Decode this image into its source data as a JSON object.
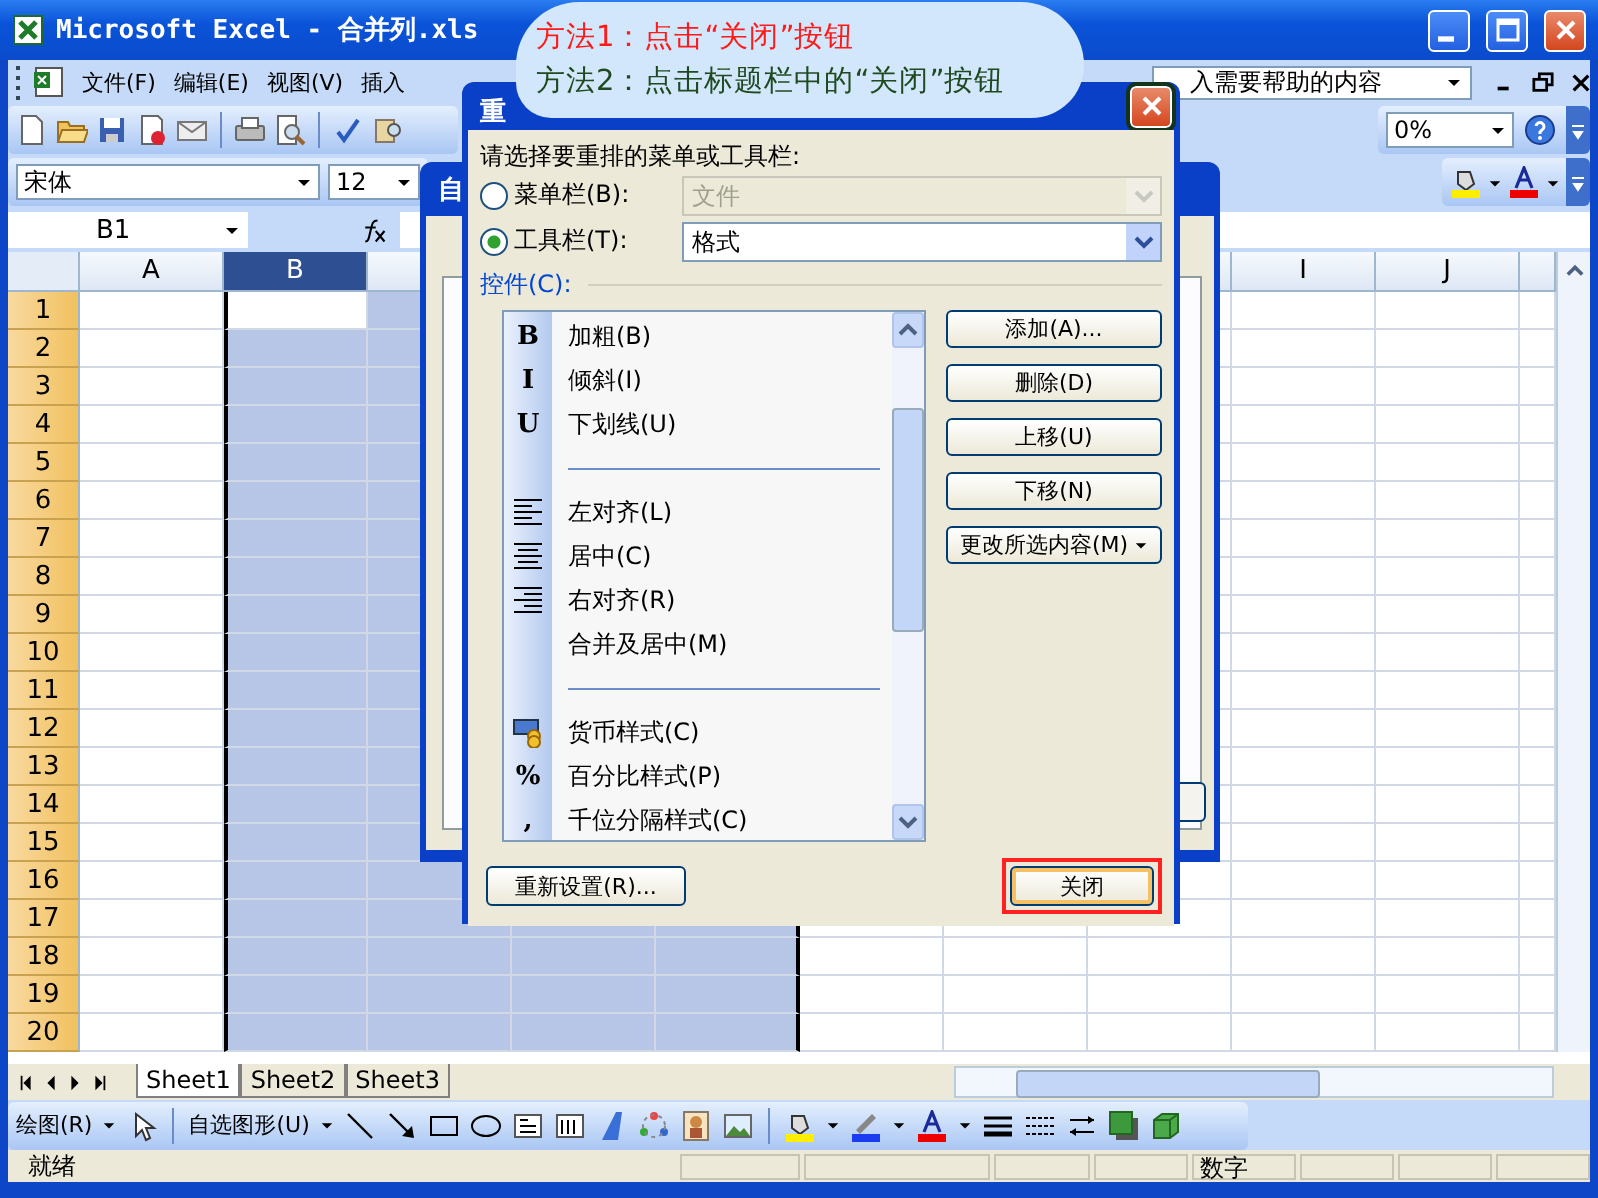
{
  "window": {
    "title": "Microsoft Excel - 合并列.xls"
  },
  "menu": {
    "items": [
      "文件(F)",
      "编辑(E)",
      "视图(V)",
      "插入"
    ],
    "help_placeholder": "入需要帮助的内容"
  },
  "standard_toolbar": {
    "zoom": "0%"
  },
  "formatting_toolbar": {
    "font": "宋体",
    "size": "12"
  },
  "formula_bar": {
    "name_box": "B1"
  },
  "grid": {
    "columns": [
      {
        "label": "A",
        "selected": false,
        "active": false
      },
      {
        "label": "B",
        "selected": true,
        "active": true
      },
      {
        "selected": true
      },
      {
        "selected": true
      },
      {
        "selected": true
      },
      {
        "selected": false
      },
      {
        "selected": false
      },
      {
        "selected": false
      },
      {
        "label": "I",
        "selected": false,
        "active": false
      },
      {
        "label": "J",
        "selected": false,
        "active": false
      }
    ],
    "rows": [
      {
        "label": "1",
        "active": true
      },
      {
        "label": "2",
        "active": false
      },
      {
        "label": "3",
        "active": false
      },
      {
        "label": "4",
        "active": false
      },
      {
        "label": "5",
        "active": false
      },
      {
        "label": "6",
        "active": false
      },
      {
        "label": "7",
        "active": false
      },
      {
        "label": "8",
        "active": false
      },
      {
        "label": "9",
        "active": false
      },
      {
        "label": "10",
        "active": false
      },
      {
        "label": "11",
        "active": false
      },
      {
        "label": "12",
        "active": false
      },
      {
        "label": "13",
        "active": false
      },
      {
        "label": "14",
        "active": false
      },
      {
        "label": "15",
        "active": false
      },
      {
        "label": "16",
        "active": false
      },
      {
        "label": "17",
        "active": false
      },
      {
        "label": "18",
        "active": false
      },
      {
        "label": "19",
        "active": false
      },
      {
        "label": "20",
        "active": false
      }
    ]
  },
  "sheets": [
    {
      "label": "Sheet1",
      "selected": true
    },
    {
      "label": "Sheet2",
      "selected": false
    },
    {
      "label": "Sheet3",
      "selected": false
    }
  ],
  "drawing_toolbar": {
    "draw_menu": "绘图(R)",
    "autoshapes_menu": "自选图形(U)"
  },
  "status_bar": {
    "state": "就绪",
    "mode": "数字"
  },
  "back_dialog": {
    "title": "自"
  },
  "dialog": {
    "title": "重",
    "prompt": "请选择要重排的菜单或工具栏:",
    "options": [
      {
        "label": "菜单栏(B):",
        "selected": false,
        "value": "文件",
        "disabled": true
      },
      {
        "label": "工具栏(T):",
        "selected": true,
        "value": "格式",
        "disabled": false
      }
    ],
    "controls_label": "控件(C):",
    "controls": [
      {
        "kind": "glyph",
        "glyph": "B",
        "label": "加粗(B)"
      },
      {
        "kind": "glyph",
        "glyph": "I",
        "label": "倾斜(I)"
      },
      {
        "kind": "glyph",
        "glyph": "U",
        "label": "下划线(U)"
      },
      {
        "kind": "separator"
      },
      {
        "kind": "left",
        "label": "左对齐(L)"
      },
      {
        "kind": "center",
        "label": "居中(C)"
      },
      {
        "kind": "right",
        "label": "右对齐(R)"
      },
      {
        "kind": "plain",
        "label": "合并及居中(M)"
      },
      {
        "kind": "separator"
      },
      {
        "kind": "currency",
        "label": "货币样式(C)"
      },
      {
        "kind": "glyph",
        "glyph": "%",
        "label": "百分比样式(P)"
      },
      {
        "kind": "glyph",
        "glyph": ",",
        "label": "千位分隔样式(C)"
      }
    ],
    "buttons": [
      {
        "label": "添加(A)...",
        "dropdown": false
      },
      {
        "label": "删除(D)",
        "dropdown": false
      },
      {
        "label": "上移(U)",
        "dropdown": false
      },
      {
        "label": "下移(N)",
        "dropdown": false
      },
      {
        "label": "更改所选内容(M)",
        "dropdown": true
      }
    ],
    "reset_button": "重新设置(R)...",
    "close_button": "关闭",
    "close_highlighted": true
  },
  "callout": {
    "lines": [
      {
        "text": "方法1：点击“关闭”按钮",
        "color": "#ff1a1a"
      },
      {
        "text": "方法2：点击标题栏中的“关闭”按钮",
        "color": "#1f4a1f"
      }
    ]
  }
}
